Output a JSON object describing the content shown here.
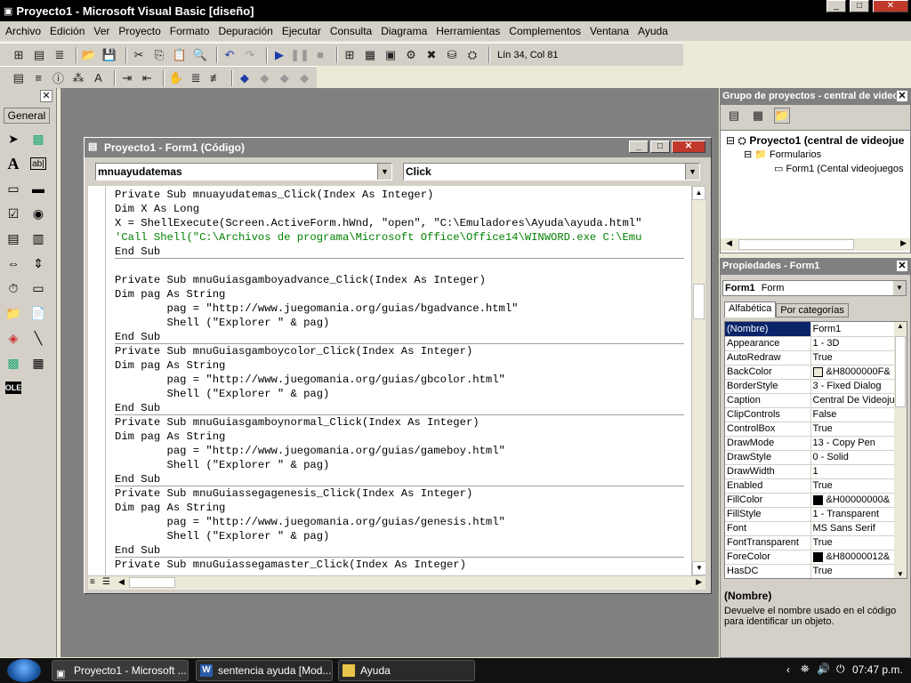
{
  "app": {
    "title": "Proyecto1 - Microsoft Visual Basic [diseño]",
    "window_controls": [
      "_",
      "□",
      "✕"
    ]
  },
  "menu": [
    "Archivo",
    "Edición",
    "Ver",
    "Proyecto",
    "Formato",
    "Depuración",
    "Ejecutar",
    "Consulta",
    "Diagrama",
    "Herramientas",
    "Complementos",
    "Ventana",
    "Ayuda"
  ],
  "toolbar": {
    "position": "Lín 34, Col 81"
  },
  "toolbox": {
    "tab": "General"
  },
  "code_window": {
    "title": "Proyecto1 - Form1 (Código)",
    "object": "mnuayudatemas",
    "procedure": "Click",
    "lines": [
      {
        "t": "Private Sub mnuayudatemas_Click(Index As Integer)",
        "k": "kw"
      },
      {
        "t": "Dim X As Long",
        "k": "kw"
      },
      {
        "t": "X = ShellExecute(Screen.ActiveForm.hWnd, \"open\", \"C:\\Emuladores\\Ayuda\\ayuda.html\"",
        "k": "kw"
      },
      {
        "t": "'Call Shell(\"C:\\Archivos de programa\\Microsoft Office\\Office14\\WINWORD.exe C:\\Emu",
        "k": "cm"
      },
      {
        "t": "End Sub",
        "k": "kw",
        "hr": true
      },
      {
        "t": "",
        "k": "kw"
      },
      {
        "t": "Private Sub mnuGuiasgamboyadvance_Click(Index As Integer)",
        "k": "kw"
      },
      {
        "t": "Dim pag As String",
        "k": "kw"
      },
      {
        "t": "        pag = \"http://www.juegomania.org/guias/bgadvance.html\"",
        "k": "kw"
      },
      {
        "t": "        Shell (\"Explorer \" & pag)",
        "k": "kw"
      },
      {
        "t": "End Sub",
        "k": "kw",
        "hr": true
      },
      {
        "t": "Private Sub mnuGuiasgamboycolor_Click(Index As Integer)",
        "k": "kw"
      },
      {
        "t": "Dim pag As String",
        "k": "kw"
      },
      {
        "t": "        pag = \"http://www.juegomania.org/guias/gbcolor.html\"",
        "k": "kw"
      },
      {
        "t": "        Shell (\"Explorer \" & pag)",
        "k": "kw"
      },
      {
        "t": "End Sub",
        "k": "kw",
        "hr": true
      },
      {
        "t": "Private Sub mnuGuiasgamboynormal_Click(Index As Integer)",
        "k": "kw"
      },
      {
        "t": "Dim pag As String",
        "k": "kw"
      },
      {
        "t": "        pag = \"http://www.juegomania.org/guias/gameboy.html\"",
        "k": "kw"
      },
      {
        "t": "        Shell (\"Explorer \" & pag)",
        "k": "kw"
      },
      {
        "t": "End Sub",
        "k": "kw",
        "hr": true
      },
      {
        "t": "Private Sub mnuGuiassegagenesis_Click(Index As Integer)",
        "k": "kw"
      },
      {
        "t": "Dim pag As String",
        "k": "kw"
      },
      {
        "t": "        pag = \"http://www.juegomania.org/guias/genesis.html\"",
        "k": "kw"
      },
      {
        "t": "        Shell (\"Explorer \" & pag)",
        "k": "kw"
      },
      {
        "t": "End Sub",
        "k": "kw",
        "hr": true
      },
      {
        "t": "Private Sub mnuGuiassegamaster_Click(Index As Integer)",
        "k": "kw"
      }
    ]
  },
  "project": {
    "title": "Grupo de proyectos - central de video juegos",
    "root": "Proyecto1 (central de videojue",
    "folder": "Formularios",
    "item": "Form1 (Cental videojuegos"
  },
  "properties": {
    "title": "Propiedades - Form1",
    "object": "Form1",
    "object_type": "Form",
    "tabs": [
      "Alfabética",
      "Por categorías"
    ],
    "rows": [
      {
        "n": "(Nombre)",
        "v": "Form1",
        "sel": true
      },
      {
        "n": "Appearance",
        "v": "1 - 3D"
      },
      {
        "n": "AutoRedraw",
        "v": "True"
      },
      {
        "n": "BackColor",
        "v": "&H8000000F&",
        "c": "#ece9d8"
      },
      {
        "n": "BorderStyle",
        "v": "3 - Fixed Dialog"
      },
      {
        "n": "Caption",
        "v": "Central De Videoju"
      },
      {
        "n": "ClipControls",
        "v": "False"
      },
      {
        "n": "ControlBox",
        "v": "True"
      },
      {
        "n": "DrawMode",
        "v": "13 - Copy Pen"
      },
      {
        "n": "DrawStyle",
        "v": "0 - Solid"
      },
      {
        "n": "DrawWidth",
        "v": "1"
      },
      {
        "n": "Enabled",
        "v": "True"
      },
      {
        "n": "FillColor",
        "v": "&H00000000&",
        "c": "#000000"
      },
      {
        "n": "FillStyle",
        "v": "1 - Transparent"
      },
      {
        "n": "Font",
        "v": "MS Sans Serif"
      },
      {
        "n": "FontTransparent",
        "v": "True"
      },
      {
        "n": "ForeColor",
        "v": "&H80000012&",
        "c": "#000000"
      },
      {
        "n": "HasDC",
        "v": "True"
      }
    ],
    "desc_title": "(Nombre)",
    "desc_text": "Devuelve el nombre usado en el código para identificar un objeto."
  },
  "taskbar": {
    "tasks": [
      "Proyecto1 - Microsoft ...",
      "sentencia ayuda [Mod...",
      "Ayuda"
    ],
    "clock": "07:47 p.m."
  }
}
